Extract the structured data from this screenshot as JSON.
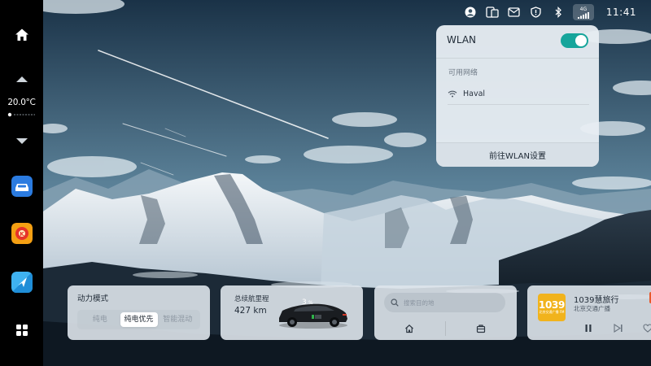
{
  "sidebar": {
    "temperature": "20.0°C",
    "items": [
      {
        "name": "home",
        "icon": "home-icon"
      },
      {
        "name": "temp-up",
        "icon": "chevron-up-icon"
      },
      {
        "name": "temp-down",
        "icon": "chevron-down-icon"
      },
      {
        "name": "vehicle",
        "icon": "car-app-icon"
      },
      {
        "name": "radio",
        "icon": "radio-app-icon"
      },
      {
        "name": "navigation",
        "icon": "navigation-app-icon"
      },
      {
        "name": "app-grid",
        "icon": "grid-icon"
      }
    ]
  },
  "status_bar": {
    "time": "11:41",
    "signal_label": "4G",
    "icons": [
      "user-icon",
      "phone-mirror-icon",
      "message-icon",
      "shield-icon",
      "bluetooth-icon",
      "signal-icon"
    ]
  },
  "wlan_panel": {
    "title": "WLAN",
    "enabled": true,
    "available_label": "可用网络",
    "networks": [
      {
        "name": "Haval"
      }
    ],
    "settings_link": "前往WLAN设置",
    "accent": "#16a59b"
  },
  "power_card": {
    "title": "动力模式",
    "modes": [
      "纯电",
      "纯电优先",
      "智能混动"
    ],
    "active": "纯电优先"
  },
  "range_card": {
    "title": "总续航里程",
    "value": "427 km",
    "battery": "3",
    "battery_unit": "%"
  },
  "nav_card": {
    "search_placeholder": "搜索目的地"
  },
  "media_card": {
    "art_label": "1039",
    "art_sub": "北京交通广播 FM",
    "title": "1039慧旅行",
    "subtitle": "北京交通广播"
  }
}
